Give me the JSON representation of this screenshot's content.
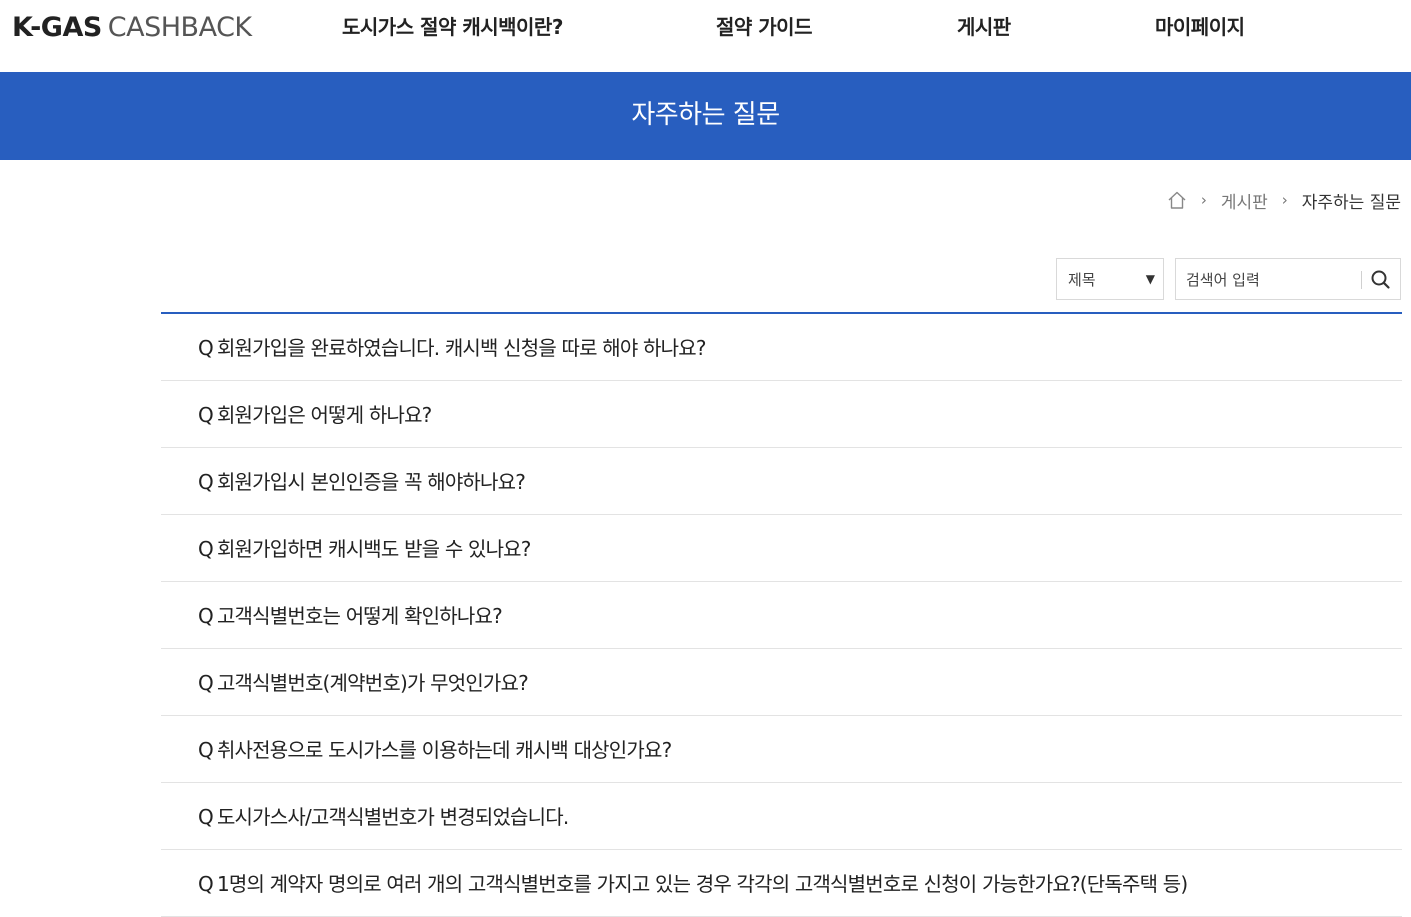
{
  "header": {
    "logo_bold": "K-GAS",
    "logo_light": "CASHBACK",
    "nav": [
      "도시가스 절약 캐시백이란?",
      "절약 가이드",
      "게시판",
      "마이페이지"
    ]
  },
  "banner": {
    "title": "자주하는 질문"
  },
  "breadcrumb": {
    "home_icon": "home-icon",
    "separator": "›",
    "parent": "게시판",
    "current": "자주하는 질문"
  },
  "search": {
    "select_value": "제목",
    "input_placeholder": "검색어 입력",
    "search_icon": "search-icon"
  },
  "faq": {
    "prefix": "Q",
    "items": [
      "회원가입을 완료하였습니다. 캐시백 신청을 따로 해야 하나요?",
      "회원가입은 어떻게 하나요?",
      "회원가입시 본인인증을 꼭 해야하나요?",
      "회원가입하면 캐시백도 받을 수 있나요?",
      "고객식별번호는 어떻게 확인하나요?",
      "고객식별번호(계약번호)가 무엇인가요?",
      "취사전용으로 도시가스를 이용하는데 캐시백 대상인가요?",
      "도시가스사/고객식별번호가 변경되었습니다.",
      "1명의 계약자 명의로 여러 개의 고객식별번호를 가지고 있는 경우 각각의 고객식별번호로 신청이 가능한가요?(단독주택 등)"
    ]
  },
  "colors": {
    "accent": "#285ebf",
    "divider": "#e3e3e3",
    "text": "#222222"
  }
}
